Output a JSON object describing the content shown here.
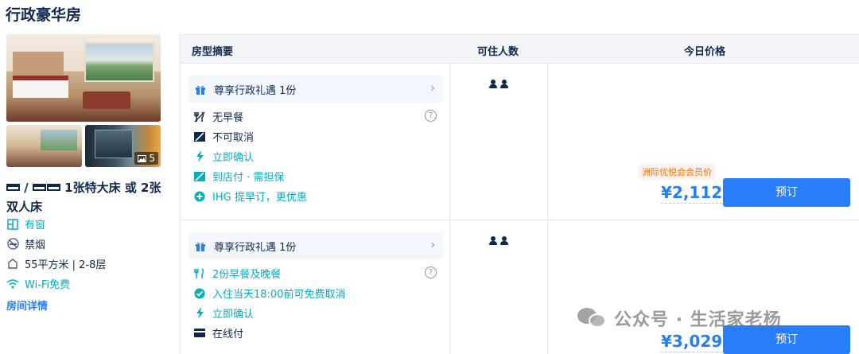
{
  "room": {
    "title": "行政豪华房",
    "photo_count": "5",
    "bed_sep": " / ",
    "bed_text": " 1张特大床 或 2张双人床",
    "facilities": {
      "window": "有窗",
      "nosmoking": "禁烟",
      "area": "55平方米 | 2-8层",
      "wifi": "Wi-Fi免费"
    },
    "detail_link": "房间详情"
  },
  "table": {
    "headers": {
      "summary": "房型摘要",
      "guests": "可住人数",
      "price": "今日价格"
    }
  },
  "offers": [
    {
      "perk": "尊享行政礼遇 1份",
      "features": [
        "无早餐",
        "不可取消",
        "立即确认",
        "到店付 · 需担保",
        "IHG 提早订，更优惠"
      ],
      "member_tag": "洲际优悦会会员价",
      "price": "¥2,112",
      "book": "预订"
    },
    {
      "perk": "尊享行政礼遇 1份",
      "features": [
        "2份早餐及晚餐",
        "入住当天18:00前可免费取消",
        "立即确认",
        "在线付"
      ],
      "price": "¥3,029",
      "book": "预订"
    }
  ],
  "watermark": "公众号 · 生活家老杨",
  "colors": {
    "accent": "#287dfa",
    "green": "#06aebd",
    "text": "#0f294d",
    "member_tag": "#ff6f00"
  }
}
